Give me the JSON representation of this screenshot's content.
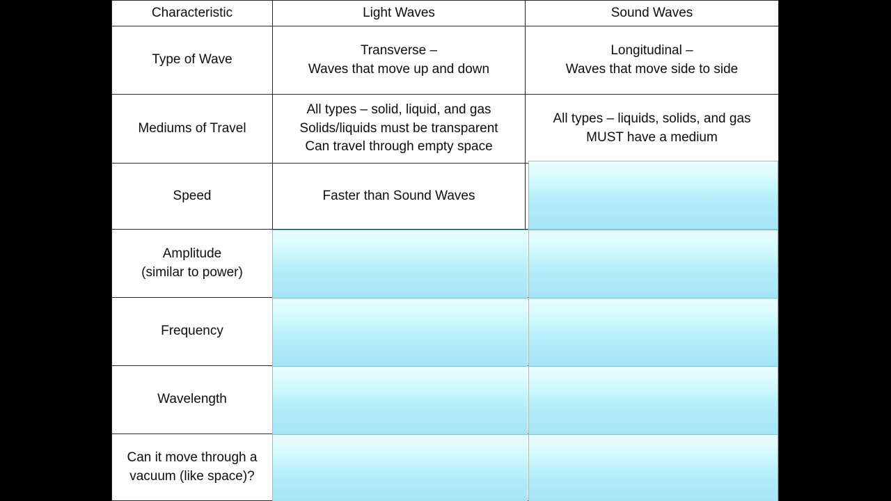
{
  "slide": {
    "background_color": "#000000",
    "table_background": "#ffffff",
    "border_color": "#262626",
    "overlay_color_top": "#e9fdfe",
    "overlay_color_bottom": "#a4e4f6",
    "overlay_border_color": "#7fc4d8"
  },
  "table": {
    "headers": {
      "characteristic": "Characteristic",
      "light_waves": "Light Waves",
      "sound_waves": "Sound Waves"
    },
    "rows": [
      {
        "characteristic": [
          "Type of Wave"
        ],
        "light": [
          "Transverse –",
          "Waves that move up and down"
        ],
        "sound": [
          "Longitudinal –",
          "Waves that move side to side"
        ],
        "light_hidden": false,
        "sound_hidden": false
      },
      {
        "characteristic": [
          "Mediums of Travel"
        ],
        "light": [
          "All types – solid, liquid, and gas",
          "Solids/liquids must be transparent",
          "Can travel through empty space"
        ],
        "sound": [
          "All types – liquids, solids, and gas",
          "MUST have a medium"
        ],
        "light_hidden": false,
        "sound_hidden": false
      },
      {
        "characteristic": [
          "Speed"
        ],
        "light": [
          "Faster than Sound Waves"
        ],
        "sound": [
          ""
        ],
        "light_hidden": false,
        "sound_hidden": true
      },
      {
        "characteristic": [
          "Amplitude",
          "(similar to power)"
        ],
        "light": [
          ""
        ],
        "sound": [
          ""
        ],
        "light_hidden": true,
        "sound_hidden": true
      },
      {
        "characteristic": [
          "Frequency"
        ],
        "light": [
          ""
        ],
        "sound": [
          ""
        ],
        "light_hidden": true,
        "sound_hidden": true
      },
      {
        "characteristic": [
          "Wavelength"
        ],
        "light": [
          ""
        ],
        "sound": [
          ""
        ],
        "light_hidden": true,
        "sound_hidden": true
      },
      {
        "characteristic": [
          "Can it move through a",
          "vacuum (like space)?"
        ],
        "light": [
          ""
        ],
        "sound": [
          ""
        ],
        "light_hidden": true,
        "sound_hidden": true
      }
    ]
  }
}
